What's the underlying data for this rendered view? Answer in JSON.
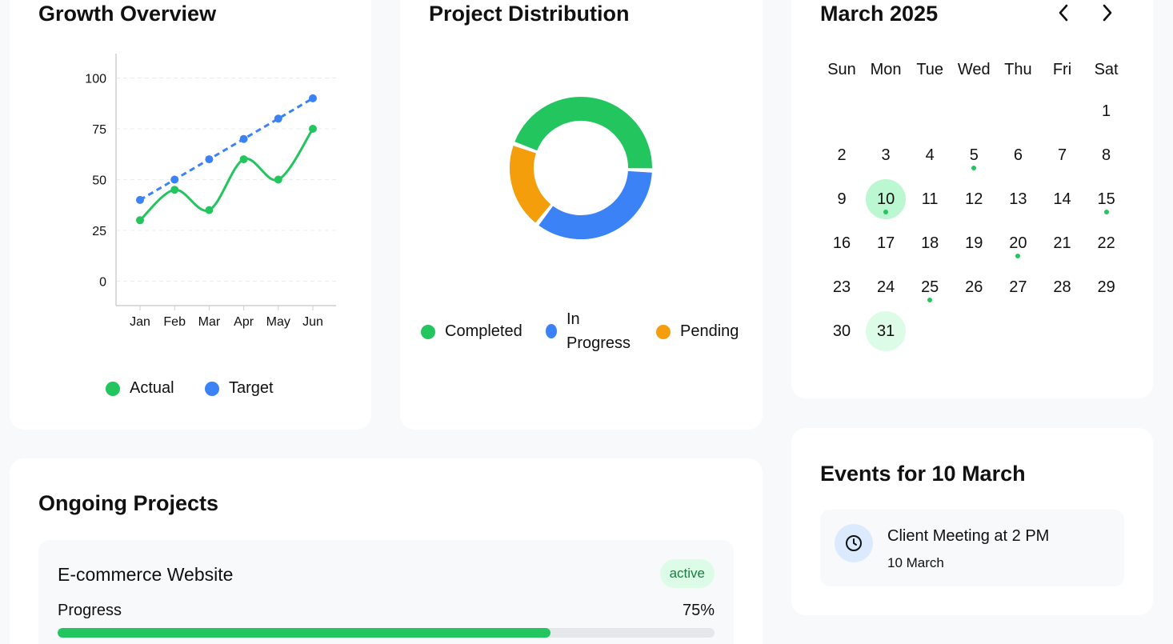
{
  "growth": {
    "title": "Growth Overview",
    "legend": [
      {
        "label": "Actual",
        "color": "#22c55e"
      },
      {
        "label": "Target",
        "color": "#3b82f6"
      }
    ]
  },
  "distribution": {
    "title": "Project Distribution",
    "legend": [
      {
        "label": "Completed",
        "color": "#22c55e"
      },
      {
        "label": "In Progress",
        "color": "#3b82f6"
      },
      {
        "label": "Pending",
        "color": "#f59e0b"
      }
    ]
  },
  "chart_data": [
    {
      "type": "line",
      "title": "Growth Overview",
      "categories": [
        "Jan",
        "Feb",
        "Mar",
        "Apr",
        "May",
        "Jun"
      ],
      "series": [
        {
          "name": "Actual",
          "values": [
            30,
            45,
            35,
            60,
            50,
            75
          ],
          "color": "#22c55e",
          "style": "smooth"
        },
        {
          "name": "Target",
          "values": [
            40,
            50,
            60,
            70,
            80,
            90
          ],
          "color": "#3b82f6",
          "style": "dashed"
        }
      ],
      "yticks": [
        0,
        25,
        50,
        75,
        100
      ],
      "ylim": [
        -12,
        112
      ],
      "grid": true,
      "legend": "bottom"
    },
    {
      "type": "pie",
      "title": "Project Distribution",
      "donut": true,
      "labels": [
        "Completed",
        "In Progress",
        "Pending"
      ],
      "values": [
        45,
        35,
        20
      ],
      "colors": [
        "#22c55e",
        "#3b82f6",
        "#f59e0b"
      ],
      "legend": "bottom"
    }
  ],
  "calendar": {
    "title": "March 2025",
    "prev_icon": "chevron-left-icon",
    "next_icon": "chevron-right-icon",
    "weekdays": [
      "Sun",
      "Mon",
      "Tue",
      "Wed",
      "Thu",
      "Fri",
      "Sat"
    ],
    "first_weekday": 6,
    "days_in_month": 31,
    "selected_day": 10,
    "today": 31,
    "event_days": [
      5,
      10,
      15,
      20,
      25
    ],
    "event_color": "#22c55e"
  },
  "projects": {
    "title": "Ongoing Projects",
    "items": [
      {
        "name": "E-commerce Website",
        "status": "active",
        "progress_label": "Progress",
        "progress_text": "75%",
        "progress": 75
      }
    ]
  },
  "events": {
    "title": "Events for 10 March",
    "items": [
      {
        "title": "Client Meeting at 2 PM",
        "date": "10 March",
        "icon": "clock-icon"
      }
    ]
  }
}
